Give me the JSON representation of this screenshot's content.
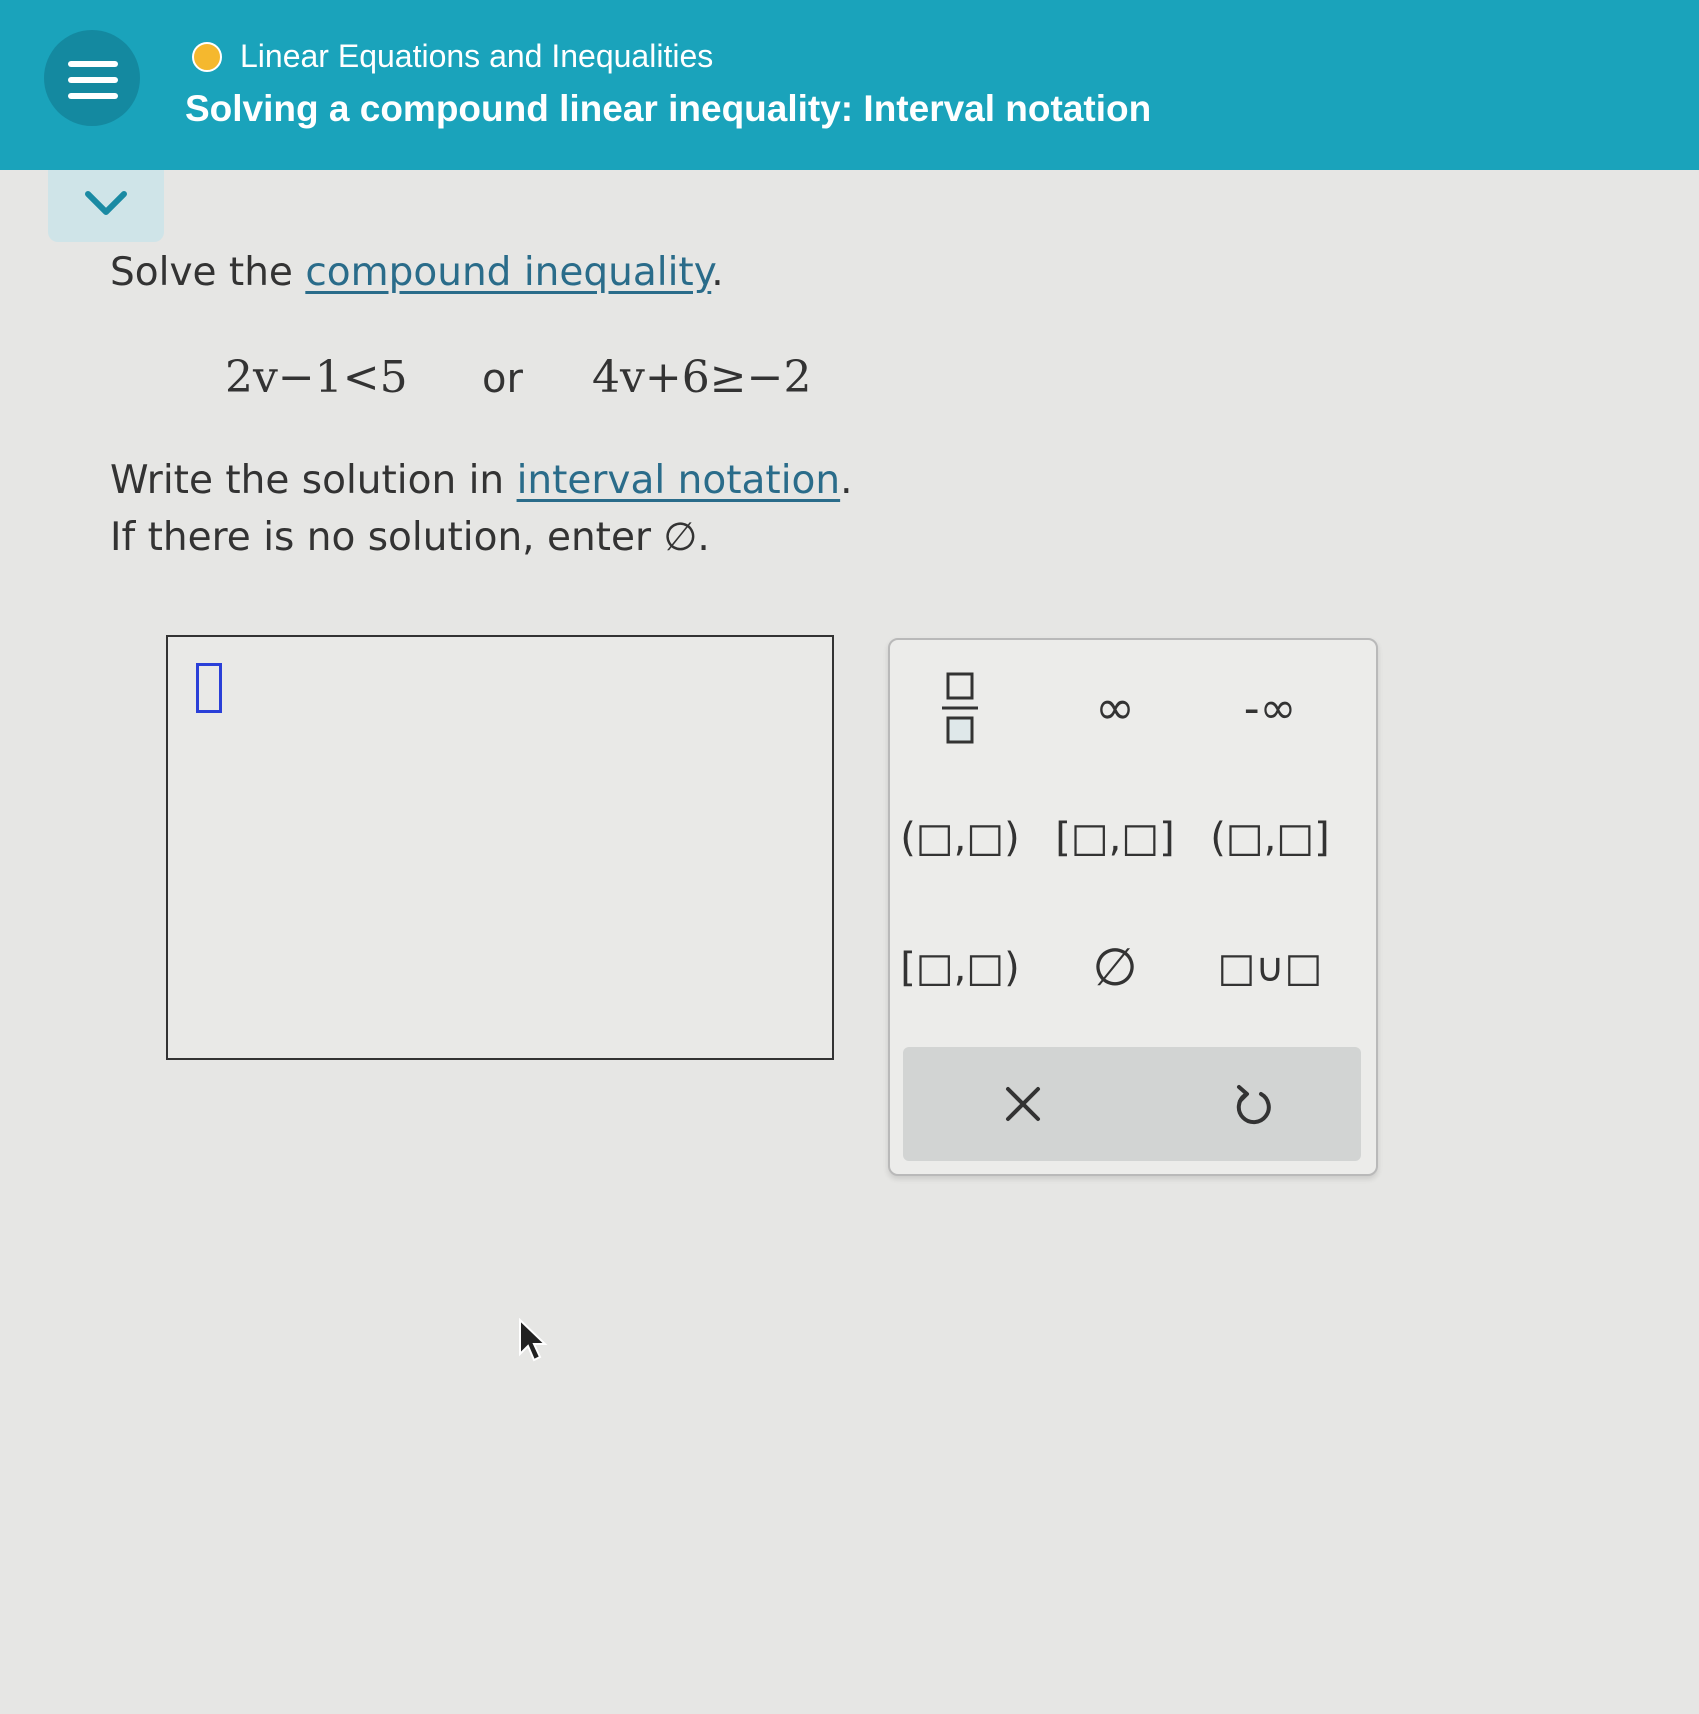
{
  "header": {
    "topic": "Linear Equations and Inequalities",
    "lesson": "Solving a compound linear inequality: Interval notation"
  },
  "problem": {
    "instruction_prefix": "Solve the ",
    "instruction_link": "compound inequality",
    "instruction_suffix": ".",
    "inequality_left": "2v−1<5",
    "connector": "or",
    "inequality_right": "4v+6≥−2",
    "answer_prefix": "Write the solution in ",
    "answer_link": "interval notation",
    "answer_suffix": ".",
    "empty_hint": "If there is no solution, enter ∅."
  },
  "keypad": {
    "keys": [
      {
        "name": "fraction",
        "label": ""
      },
      {
        "name": "infinity",
        "label": "∞"
      },
      {
        "name": "negative-infinity",
        "label": "-∞"
      },
      {
        "name": "open-interval",
        "label": "(□,□)"
      },
      {
        "name": "closed-interval",
        "label": "[□,□]"
      },
      {
        "name": "left-open-interval",
        "label": "(□,□]"
      },
      {
        "name": "right-open-interval",
        "label": "[□,□)"
      },
      {
        "name": "empty-set",
        "label": "∅"
      },
      {
        "name": "union",
        "label": "□∪□"
      }
    ]
  },
  "colors": {
    "header_bg": "#1aa3bb",
    "link": "#2a6c8a",
    "topic_dot": "#f5b82e",
    "cursor": "#2a3fd8"
  },
  "icons": [
    "menu-icon",
    "chevron-down-icon",
    "clear-icon",
    "undo-icon",
    "mouse-pointer-icon"
  ]
}
